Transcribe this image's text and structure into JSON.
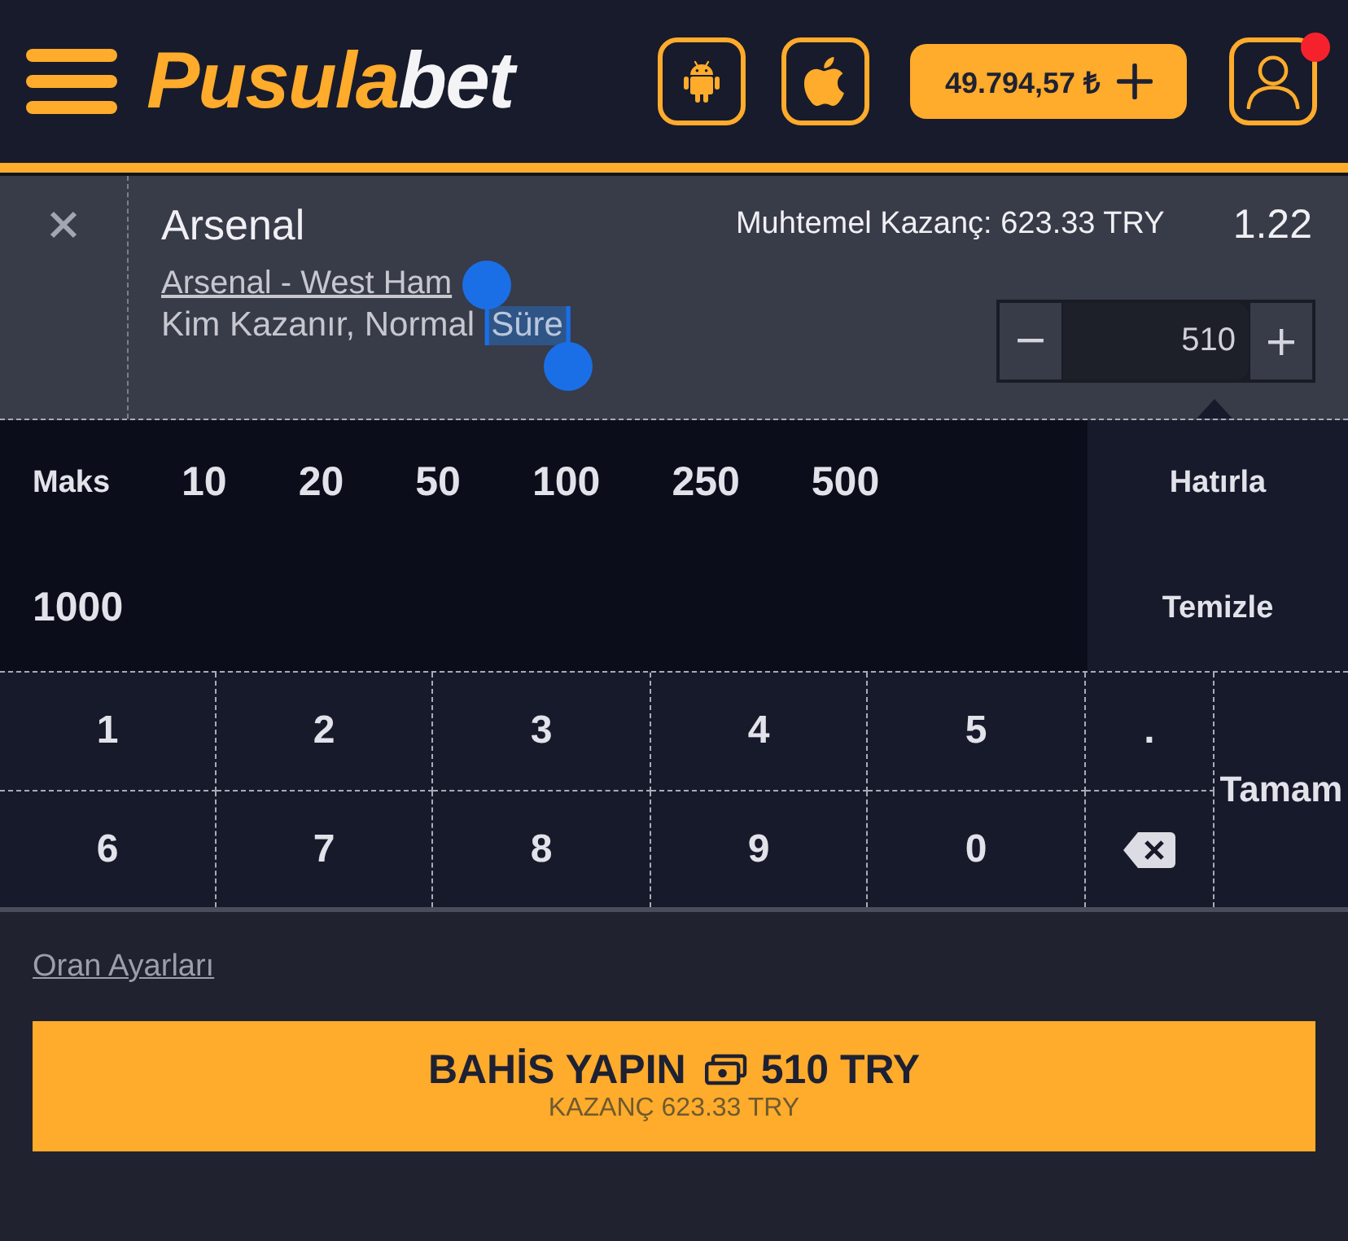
{
  "header": {
    "logo": {
      "primary": "Pusula",
      "secondary": "bet"
    },
    "balance": "49.794,57 ₺",
    "notification": true
  },
  "bet": {
    "team": "Arsenal",
    "match": "Arsenal - West Ham",
    "market": [
      {
        "text": "Kim Kazanır, Normal",
        "selected": false
      },
      {
        "text": "Süre",
        "selected": true
      }
    ],
    "potential_win": "Muhtemel Kazanç: 623.33 TRY",
    "odds": "1.22",
    "stake": "510"
  },
  "quick_stakes": [
    "Maks",
    "10",
    "20",
    "50",
    "100",
    "250",
    "500",
    "1000"
  ],
  "quick_actions": [
    "Hatırla",
    "Temizle"
  ],
  "keypad": {
    "keys": [
      {
        "kind": "key",
        "label": "1"
      },
      {
        "kind": "key",
        "label": "2"
      },
      {
        "kind": "key",
        "label": "3"
      },
      {
        "kind": "key",
        "label": "4"
      },
      {
        "kind": "key",
        "label": "5"
      },
      {
        "kind": "key",
        "label": "."
      },
      {
        "kind": "key",
        "label": "6"
      },
      {
        "kind": "key",
        "label": "7"
      },
      {
        "kind": "key",
        "label": "8"
      },
      {
        "kind": "key",
        "label": "9"
      },
      {
        "kind": "key",
        "label": "0"
      },
      {
        "kind": "backspace"
      }
    ],
    "confirm": "Tamam"
  },
  "footer": {
    "odds_settings": "Oran Ayarları",
    "place_bet": {
      "label": "BAHİS YAPIN",
      "amount": "510 TRY",
      "winnings": "KAZANÇ 623.33 TRY"
    }
  }
}
